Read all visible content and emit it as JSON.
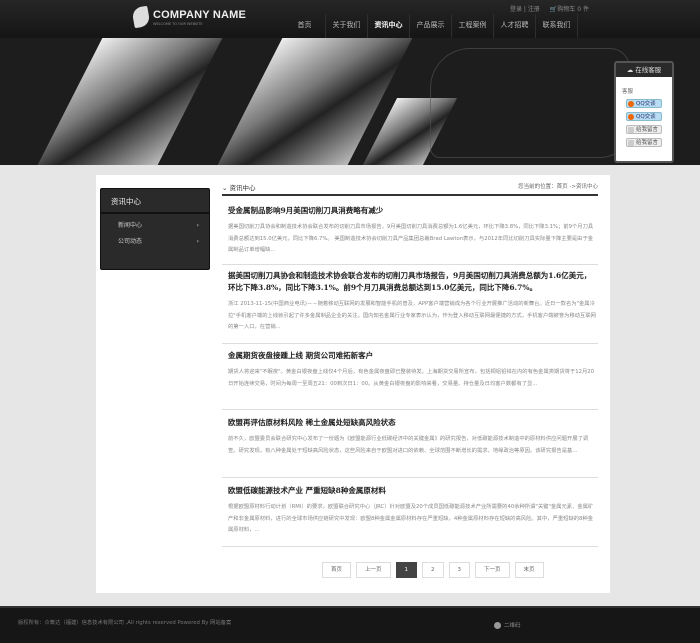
{
  "header": {
    "company": "COMPANY NAME",
    "tagline": "WELCOME TO OUR WEBSITE",
    "login": "登录 | 注册",
    "cart": "购物车 0 件",
    "nav": [
      "首页",
      "关于我们",
      "资讯中心",
      "产品展示",
      "工程案例",
      "人才招聘",
      "联系我们"
    ],
    "active_nav": 2
  },
  "widget": {
    "title": "在线客服",
    "label": "客服",
    "qq1": "QQ交谈",
    "qq2": "QQ交谈",
    "msg1": "给我留言",
    "msg2": "给我留言"
  },
  "sidebar": {
    "title": "资讯中心",
    "items": [
      "新闻中心",
      "公司动态"
    ]
  },
  "main": {
    "title": "资讯中心",
    "breadcrumb": "您当前的位置：首页 ->资讯中心",
    "articles": [
      {
        "title": "受金属制品影响9月美国切削刀具消费略有减少",
        "body": "据美国切削刀具协会和制造技术协会联合发布的切削刀具市场报告，9月美国切削刀具消费总额为1.6亿美元，环比下降3.8%，同比下降3.1%；前9个月刀具消费总额达到15.0亿美元，同比下降6.7%。 美国制造技术协会切削刀具产品集团总裁Brad Lawton表示，与2012年同比切削刀具实际量下降主要是由于金属制品订单增幅缺..."
      },
      {
        "title": "据美国切削刀具协会和制造技术协会联合发布的切削刀具市场报告，9月美国切削刀具消费总额为1.6亿美元，环比下降3.8%，同比下降3.1%。前9个月刀具消费总额达到15.0亿美元，同比下降6.7%。",
        "body": "浙江 2013-11-15(中国商业电讯)－－随着移动互联网的发展和智能手机的普及，APP客户端营销成为各个行业开展推广活动的新舞台。近日一款名为\"金属冷拉\"手机客户端的上线就引起了许多金属制品企业的关注。国内知名金属行业专家表示认为，作为登入移动互联网最便捷的方式，手机客户端被誉为移动互联网的第一入口，在营销..."
      },
      {
        "title": "金属期货夜盘接踵上线 期货公司难拓新客户",
        "body": "期货人将迎来\"不眠夜\"。黄金白银夜盘上线仅4个月后，有色金属夜盘即已整装待发。上海期货交易所宣布，包括铜铝铅锌在内的有色金属类期货将于12月20日开始连续交易，时间为每周一至周五21：00到次日1：00。从黄金白银夜盘的影响来看，交易量、持仓量及日均客户数都有了显..."
      },
      {
        "title": "欧盟再评估原材料风险 稀土金属处短缺高风险状态",
        "body": "前不久，欧盟委员会联合研究中心发布了一份题为《欧盟能源行业低碳经济中的关键金属》的研究报告，对低碳能源技术制造中的原材料供应问题开展了调查。研究发现，有八种金属处于短缺高风险状态，这些风险来自于欧盟对进口的依赖、全球范围不断增长的需求、地缘政治等原因。该研究报告是基..."
      },
      {
        "title": "欧盟低碳能源技术产业 严重短缺8种金属原材料",
        "body": "根据欧盟原材料行动计划（RMI）的要求，欧盟联合研究中心（JRC）针对欧盟及20个成员国低碳能源技术产业所需要的40余种所谓\"关键\"金属元素、金属矿产和非金属原材料，进行的全球市场供应链研究中发现：欧盟8种金属金属原材料存在严重短缺，4种金属原材料存在短缺的高风险。其中，严重短缺的8种金属原材料，..."
      }
    ]
  },
  "pagination": {
    "first": "首页",
    "prev": "上一页",
    "pages": [
      "1",
      "2",
      "3"
    ],
    "current": "1",
    "next": "下一页",
    "last": "末页"
  },
  "footer": {
    "copyright": "版权所有：众筹达（福建）信息技术有限公司 ,All rights reserved Powered By 网站备案",
    "qrcode": "二维码"
  }
}
